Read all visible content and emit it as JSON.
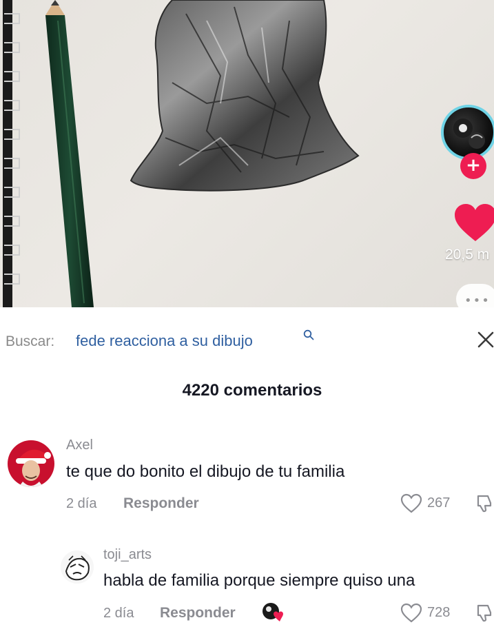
{
  "video": {
    "like_count": "20,5 m",
    "follow_symbol": "+",
    "more_symbol": "•••"
  },
  "search": {
    "prefix": "Buscar:",
    "term": "fede reacciona a su dibujo"
  },
  "comments": {
    "count_label": "4220 comentarios",
    "items": [
      {
        "username": "Axel",
        "text": "te que do bonito el dibujo de tu familia",
        "time": "2 día",
        "reply_label": "Responder",
        "likes": "267"
      },
      {
        "username": "toji_arts",
        "text": "habla de familia porque siempre quiso una",
        "time": "2 día",
        "reply_label": "Responder",
        "likes": "728"
      }
    ]
  },
  "colors": {
    "accent_red": "#ee1d52",
    "link_blue": "#2f5fa0",
    "muted_gray": "#8a8b91",
    "text_dark": "#161823",
    "avatar_ring": "#6fd3e6"
  }
}
